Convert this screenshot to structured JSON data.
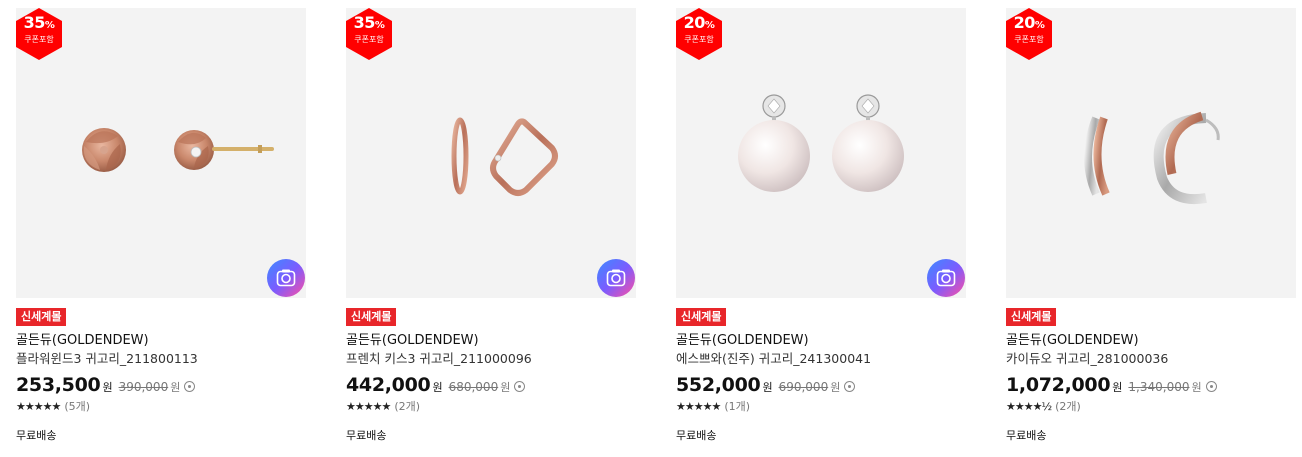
{
  "colors": {
    "accent": "#e8262a",
    "badge": "#ff0000",
    "image_bg": "#f3f3f3"
  },
  "products": [
    {
      "discount_pct": "35",
      "discount_unit": "%",
      "discount_sub": "쿠폰포함",
      "tag": "신세계몰",
      "brand": "골든듀(GOLDENDEW)",
      "name": "플라워윈드3 귀고리_211800113",
      "price": "253,500",
      "price_unit": "원",
      "original_price": "390,000",
      "original_unit": "원",
      "stars": "★★★★★",
      "rating": 5,
      "review_count": "(5개)",
      "shipping": "무료배송",
      "has_camera_button": true,
      "image_icon": "flower-earring-image"
    },
    {
      "discount_pct": "35",
      "discount_unit": "%",
      "discount_sub": "쿠폰포함",
      "tag": "신세계몰",
      "brand": "골든듀(GOLDENDEW)",
      "name": "프렌치 키스3 귀고리_211000096",
      "price": "442,000",
      "price_unit": "원",
      "original_price": "680,000",
      "original_unit": "원",
      "stars": "★★★★★",
      "rating": 5,
      "review_count": "(2개)",
      "shipping": "무료배송",
      "has_camera_button": true,
      "image_icon": "hoop-earring-image"
    },
    {
      "discount_pct": "20",
      "discount_unit": "%",
      "discount_sub": "쿠폰포함",
      "tag": "신세계몰",
      "brand": "골든듀(GOLDENDEW)",
      "name": "에스쁘와(진주) 귀고리_241300041",
      "price": "552,000",
      "price_unit": "원",
      "original_price": "690,000",
      "original_unit": "원",
      "stars": "★★★★★",
      "rating": 5,
      "review_count": "(1개)",
      "shipping": "무료배송",
      "has_camera_button": true,
      "image_icon": "pearl-earring-image"
    },
    {
      "discount_pct": "20",
      "discount_unit": "%",
      "discount_sub": "쿠폰포함",
      "tag": "신세계몰",
      "brand": "골든듀(GOLDENDEW)",
      "name": "카이듀오 귀고리_281000036",
      "price": "1,072,000",
      "price_unit": "원",
      "original_price": "1,340,000",
      "original_unit": "원",
      "stars": "★★★★½",
      "rating": 4.5,
      "review_count": "(2개)",
      "shipping": "무료배송",
      "has_camera_button": false,
      "image_icon": "two-tone-hoop-earring-image"
    }
  ]
}
